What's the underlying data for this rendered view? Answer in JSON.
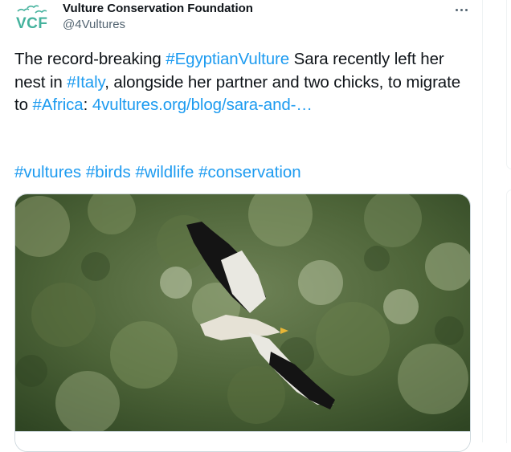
{
  "author": {
    "name": "Vulture Conservation Foundation",
    "handle": "@4Vultures",
    "avatar_text": "VCF",
    "avatar_icon": "flying-birds-logo"
  },
  "tweet": {
    "t1": "The record-breaking ",
    "h1": "#EgyptianVulture",
    "t2": " Sara recently left her nest in ",
    "h2": "#Italy",
    "t3": ", alongside her partner and two chicks, to migrate to ",
    "h3": "#Africa",
    "t4": ": ",
    "link": "4vultures.org/blog/sara-and-…"
  },
  "hashtags": [
    "#vultures",
    "#birds",
    "#wildlife",
    "#conservation"
  ],
  "colors": {
    "link": "#1d9bf0",
    "brand": "#45b29d",
    "text": "#0f1419",
    "secondary": "#536471"
  },
  "media": {
    "subject": "Egyptian vulture in flight over green forest",
    "icon": "photo-image"
  },
  "actions": {
    "more_icon": "more-horizontal-icon"
  }
}
